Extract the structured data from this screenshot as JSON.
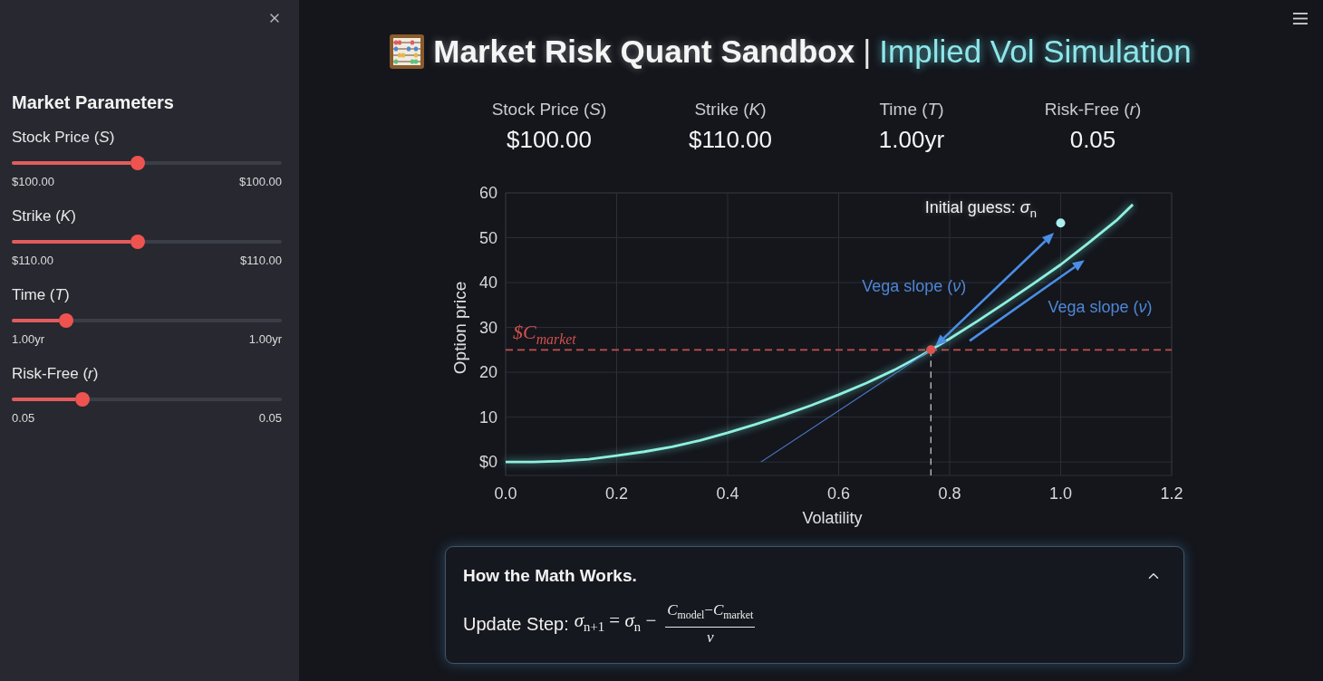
{
  "sidebar": {
    "title": "Market Parameters",
    "sliders": [
      {
        "label": "Stock Price (*S*)",
        "level": 0.466,
        "min_label": "$100.00",
        "max_label": "$100.00"
      },
      {
        "label": "Strike (*K*)",
        "level": 0.466,
        "min_label": "$110.00",
        "max_label": "$110.00"
      },
      {
        "label": "Time (*T*)",
        "level": 0.2,
        "min_label": "1.00yr",
        "max_label": "1.00yr"
      },
      {
        "label": "Risk-Free (*r*)",
        "level": 0.262,
        "min_label": "0.05",
        "max_label": "0.05"
      }
    ]
  },
  "header": {
    "title": "Market Risk Quant Sandbox",
    "separator": "|",
    "subtitle": "Implied Vol Simulation"
  },
  "metrics": [
    {
      "label": "Stock Price (*S*)",
      "value": "$100.00"
    },
    {
      "label": "Strike (*K*)",
      "value": "$110.00"
    },
    {
      "label": "Time (*T*)",
      "value": "1.00yr"
    },
    {
      "label": "Risk-Free (*r*)",
      "value": "0.05"
    }
  ],
  "chart": {
    "chart_data": {
      "type": "line",
      "xlabel": "Volatility",
      "ylabel": "Option price",
      "x": [
        0,
        0.05,
        0.1,
        0.15,
        0.2,
        0.25,
        0.3,
        0.35,
        0.4,
        0.45,
        0.5,
        0.55,
        0.6,
        0.65,
        0.7,
        0.75,
        0.8,
        0.85,
        0.9,
        0.95,
        1.0,
        1.05,
        1.1,
        1.13
      ],
      "values": [
        0,
        0,
        0.2,
        0.6,
        1.4,
        2.3,
        3.4,
        4.8,
        6.5,
        8.4,
        10.4,
        12.6,
        15,
        17.6,
        20.5,
        23.8,
        27.5,
        31.4,
        35.5,
        39.7,
        44,
        48.8,
        53.8,
        57.4
      ],
      "xlim": [
        0,
        1.2
      ],
      "ylim": [
        -3,
        60
      ],
      "xticks": [
        {
          "value": 0,
          "label": "0.0"
        },
        0.2,
        0.4,
        0.6,
        0.8,
        {
          "value": 1,
          "label": "1.0"
        },
        1.2
      ],
      "yticks": [
        {
          "value": 0,
          "label": "$0"
        },
        10,
        20,
        30,
        40,
        50,
        60
      ],
      "grid": true,
      "ref_lines": [
        {
          "axis": "y",
          "value": 25,
          "label": "$C$_{market}$"
        }
      ],
      "annotations": [
        "Vega slope (*ν*)",
        "Vega slope (*ν*)",
        "Initial guess: *σ*$_{n}$"
      ]
    }
  },
  "expander": {
    "title": "How the Math Works.",
    "expanded": true,
    "label": "Update Step:",
    "formula": {
      "lhs": "*σ*$_{n+1}$ = *σ*$_{n}$ −",
      "numerator": "*C*$_{model}$−*C*$_{market}$",
      "denominator": "*ν*"
    }
  }
}
